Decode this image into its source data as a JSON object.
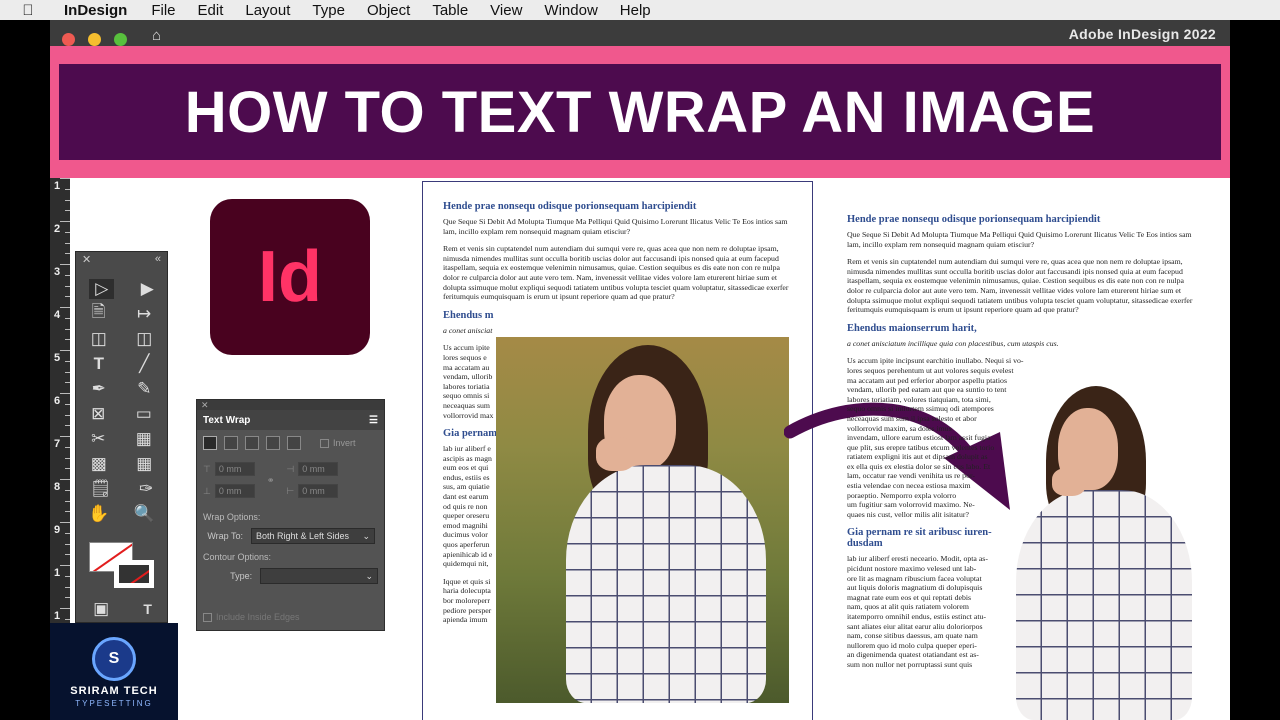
{
  "menu": {
    "app": "InDesign",
    "items": [
      "File",
      "Edit",
      "Layout",
      "Type",
      "Object",
      "Table",
      "View",
      "Window",
      "Help"
    ]
  },
  "window": {
    "title": "Adobe InDesign 2022"
  },
  "banner": {
    "headline": "HOW TO TEXT WRAP AN IMAGE",
    "colors": {
      "outer": "#f0588d",
      "inner": "#4d0b4e"
    }
  },
  "ruler": {
    "numbers": [
      "1",
      "2",
      "3",
      "4",
      "5",
      "6",
      "7",
      "8",
      "9",
      "1",
      "1",
      "1"
    ]
  },
  "logo": {
    "text": "Id",
    "colors": {
      "bg": "#49021f",
      "fg": "#ff3366"
    }
  },
  "text_wrap_panel": {
    "title": "Text Wrap",
    "invert_label": "Invert",
    "offset_value": "0 mm",
    "wrap_options_label": "Wrap Options:",
    "wrap_to_label": "Wrap To:",
    "wrap_to_value": "Both Right & Left Sides",
    "contour_options_label": "Contour Options:",
    "type_label": "Type:",
    "type_value": "",
    "include_inside_edges_label": "Include Inside Edges"
  },
  "brand": {
    "line1": "SRIRAM TECH",
    "line2": "TYPESETTING",
    "mono": "S"
  },
  "doc_left": {
    "h1": "Hende prae nonsequ odisque porionsequam harcipiendit",
    "p1": "Que Seque Si Debit Ad Molupta Tiumque Ma Pelliqui Quid Quisimo Lorerunt Ilicatus Velic Te Eos intios sam lam, incillo explam rem nonsequid magnam quiam etisciur?",
    "p2": "Rem et venis sin cuptatendel num autendiam dui sumqui vere re, quas acea que non nem re doluptae ipsam, nimusda nimendes mullitas sunt occulla boritib uscias dolor aut faccusandi ipis nonsed quia at eum facepud itaspellam, sequia ex eostemque velenimin nimusamus, quiae. Cestion sequibus es dis eate non con re nulpa dolor re culparcia dolor aut aute vero tem. Nam, invenessit vellitae vides volore lam eturerent hiriae sum et dolupta ssimuque molut expliqui sequodi tatiatem untibus volupta tesciet quam voluptatur, sitassedicae exerfer feritumquis eumquisquam is erum ut ipsunt reperiore quam ad que pratur?",
    "h2": "Ehendus m",
    "p3": "a conet anisciat",
    "p4": [
      "Us accum ipite",
      "lores sequos e",
      "ma accatam au",
      "vendam, ullorib",
      "labores toriatia",
      "sequo omnis si",
      "neceaquas sum",
      "vollorrovid max"
    ],
    "h3": "Gia pernam",
    "p5": [
      "lab iur aliberf e",
      "ascipis as magn",
      "eum eos et qui",
      "endus, estiis es",
      "sus, am quiatie",
      "dant est earum",
      "od quis re non",
      "queper oreseru",
      "emod magnihi",
      "ducimus volor",
      "quos aperferun",
      "apienihicab id e",
      "quidemqui nit,"
    ],
    "p6": [
      "Iqque et quis si",
      "haria dolecupta",
      "bor moloreperr",
      "pediore persper",
      "apienda imum"
    ]
  },
  "doc_right": {
    "h1": "Hende prae nonsequ odisque porionsequam harcipiendit",
    "p1": "Que Seque Si Debit Ad Molupta Tiumque Ma Pelliqui Quid Quisimo Lorerunt Ilicatus Velic Te Eos intios sam lam, incillo explam rem nonsequid magnam quiam etisciur?",
    "p2": "Rem et venis sin cuptatendel num autendiam dui sumqui vere re, quas acea que non nem re doluptae ipsam, nimusda nimendes mullitas sunt occulla boritib uscias dolor aut faccusandi ipis nonsed quia at eum facepud itaspellam, sequia ex eostemque velenimin nimusamus, quiae. Cestion sequibus es dis eate non con re nulpa dolor re culparcia dolor aut aute vero tem. Nam, invenessit vellitae vides volore lam eturerent hiriae sum et dolupta ssimuque molut expliqui sequodi tatiatem untibus volupta tesciet quam voluptatur, sitassedicae exerfer feritumquis eumquisquam is erum ut ipsunt reperiore quam ad que pratur?",
    "h2": "Ehendus maionserrum harit,",
    "p3": "a conet anisciatum incillique quia con placestibus, cum utaspis cus.",
    "p4": [
      "Us accum ipite incipsunt earchitio inullabo. Nequi si vo-",
      "lores sequos perehentum ut aut volores sequis evelest",
      "ma accatam aut ped erferior aborpor aspellu ptatios",
      "vendam, ullorib ped eatam aut que ea suntio to tent",
      "labores toriatiam, volores tiatquiam, tota simi,",
      "sequo omnis si intiurtem ssimuq odi atempores",
      "neceaquas sum sum il ipsa solesto et abor",
      "vollorrovid maxim, sa doles imus",
      "invendam, ullore earum estiost lam assit fugia",
      "que plit, sus erepre tatibus etcum volentes torio",
      "ratiatem expligni itis aut et dipsam dolupit as",
      "ex ella quis ex elestia dolor se sin cus labo. Et",
      "lam, occatur rae vendi venihita us re por-",
      "estia velendae con necea estiosa maxim",
      "poraeptio. Nemporro expla volorro",
      "um fugitiur sam volorrovid maximo. Ne-",
      "quaes nis cust, vellor milis alit isitatur?"
    ],
    "h3": "Gia pernam re sit aribusc iuren-dusdam",
    "p5": [
      "lab iur aliberf eresti neceario. Modit, opta as-",
      "picidunt nostore maximo velesed unt lab-",
      "ore lit as magnam ribuscium facea voluptat",
      "aut liquis doloris magnatium di dolupisquis",
      "magnat rate eum eos et qui reptati debis",
      "nam, quos at alit quis ratiatem volorem",
      "itatemporro omnihil endus, estiis estinct atu-",
      "sant aliates eiur alitat earur aliu doloriorpos",
      "nam, conse sitibus daessus, am quate nam",
      "nullorem quo id molo culpa queper eperi-",
      "an digenimenda quatest otatiandant est as-",
      "sum non nullor net porruptassi sunt quis"
    ]
  }
}
